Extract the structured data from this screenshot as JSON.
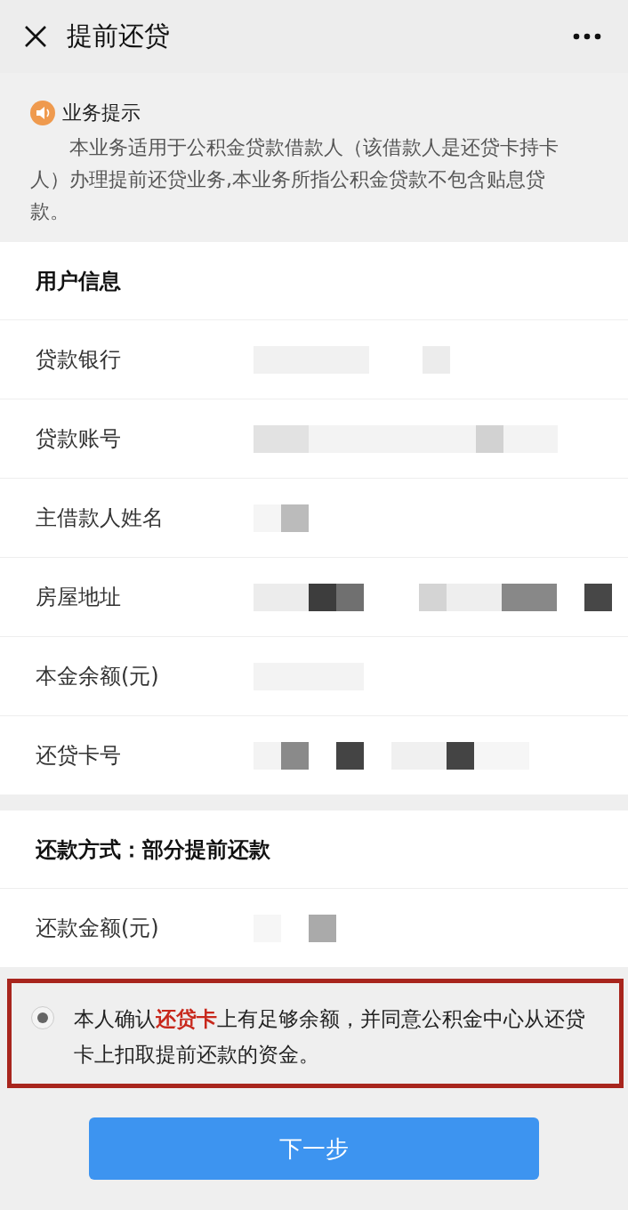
{
  "header": {
    "title": "提前还贷"
  },
  "notice": {
    "title": "业务提示",
    "text": "本业务适用于公积金贷款借款人（该借款人是还贷卡持卡人）办理提前还贷业务,本业务所指公积金贷款不包含贴息贷款。"
  },
  "user_info": {
    "heading": "用户信息",
    "fields": [
      {
        "label": "贷款银行"
      },
      {
        "label": "贷款账号"
      },
      {
        "label": "主借款人姓名"
      },
      {
        "label": "房屋地址"
      },
      {
        "label": "本金余额(元)"
      },
      {
        "label": "还贷卡号"
      }
    ]
  },
  "repayment": {
    "heading": "还款方式：部分提前还款",
    "fields": [
      {
        "label": "还款金额(元)"
      }
    ]
  },
  "confirm": {
    "selected": true,
    "text": "本人确认**还贷卡**上有足够余额，并同意公积金中心从还贷卡上扣取提前还款的资金。"
  },
  "next_button": "下一步"
}
